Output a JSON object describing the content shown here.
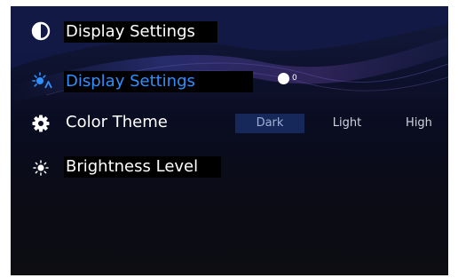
{
  "header": {
    "title": "Display Settings",
    "icon": "contrast-icon"
  },
  "settings": {
    "display": {
      "label": "Display Settings",
      "icon": "display-brightness-icon",
      "toggle_state": "0",
      "active_color": "#2f8fff"
    },
    "color_theme": {
      "label": "Color Theme",
      "icon": "gear-icon",
      "options": [
        "Dark",
        "Light",
        "High"
      ],
      "selected": "Dark"
    },
    "brightness": {
      "label": "Brightness Level",
      "icon": "brightness-icon"
    }
  }
}
